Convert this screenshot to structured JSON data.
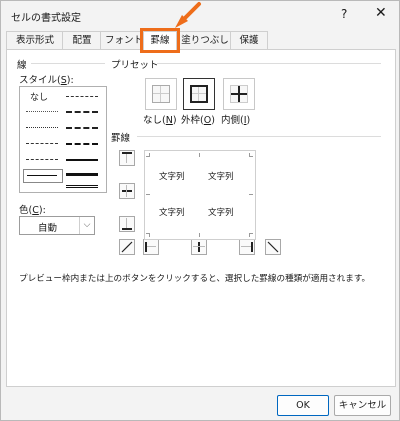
{
  "window": {
    "title": "セルの書式設定",
    "help_label": "?",
    "close_label": "✕"
  },
  "tabs": [
    {
      "label": "表示形式",
      "active": false
    },
    {
      "label": "配置",
      "active": false
    },
    {
      "label": "フォント",
      "active": false
    },
    {
      "label": "罫線",
      "active": true
    },
    {
      "label": "塗りつぶし",
      "active": false
    },
    {
      "label": "保護",
      "active": false
    }
  ],
  "line_section": {
    "title": "線",
    "style_label": "スタイル(",
    "style_key": "S",
    "style_label_end": "):",
    "none_label": "なし",
    "color_label": "色(",
    "color_key": "C",
    "color_label_end": "):",
    "color_value": "自動"
  },
  "presets": {
    "title": "プリセット",
    "items": [
      {
        "label": "なし(",
        "key": "N",
        "end": ")"
      },
      {
        "label": "外枠(",
        "key": "O",
        "end": ")"
      },
      {
        "label": "内側(",
        "key": "I",
        "end": ")"
      }
    ]
  },
  "border_section": {
    "title": "罫線"
  },
  "preview_texts": [
    "文字列",
    "文字列",
    "文字列",
    "文字列"
  ],
  "note": "プレビュー枠内または上のボタンをクリックすると、選択した罫線の種類が適用されます。",
  "footer": {
    "ok_label": "OK",
    "cancel_label": "キャンセル"
  },
  "colors": {
    "highlight": "#ee6d1a",
    "accent": "#0067c0"
  },
  "icons": {
    "arrow": "arrow-icon"
  }
}
